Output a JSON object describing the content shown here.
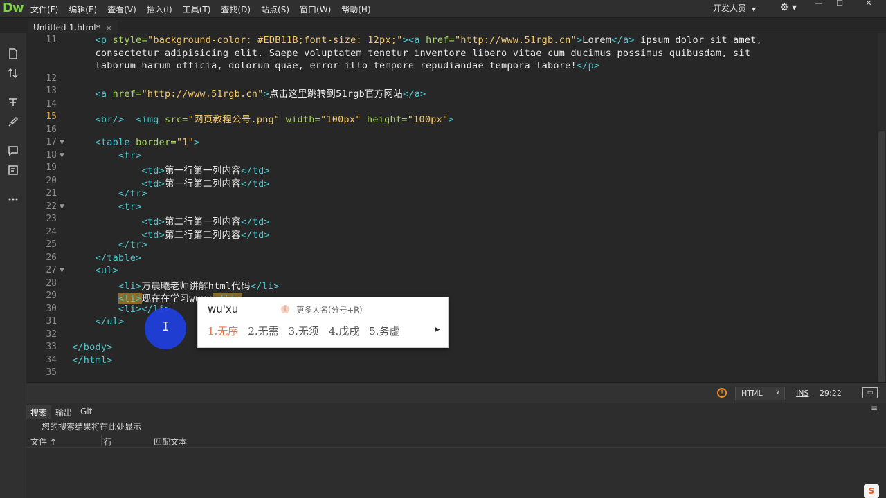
{
  "app": {
    "logo": "Dw",
    "menus": [
      "文件(F)",
      "编辑(E)",
      "查看(V)",
      "插入(I)",
      "工具(T)",
      "查找(D)",
      "站点(S)",
      "窗口(W)",
      "帮助(H)"
    ],
    "workspace": "开发人员",
    "gear": "⚙ ▾",
    "window_buttons": [
      "—",
      "☐",
      "✕"
    ]
  },
  "tab": {
    "label": "Untitled-1.html*",
    "close": "×"
  },
  "toolbar": [
    "file-icon",
    "sort-icon",
    "tree-icon",
    "brush-icon",
    "comment-icon",
    "snippet-icon",
    "more-icon"
  ],
  "editor": {
    "current_line": "15",
    "gutter": [
      {
        "n": "11",
        "fold": ""
      },
      {
        "n": "12",
        "fold": ""
      },
      {
        "n": "13",
        "fold": ""
      },
      {
        "n": "14",
        "fold": ""
      },
      {
        "n": "15",
        "fold": ""
      },
      {
        "n": "16",
        "fold": ""
      },
      {
        "n": "17",
        "fold": "▼"
      },
      {
        "n": "18",
        "fold": "▼"
      },
      {
        "n": "19",
        "fold": ""
      },
      {
        "n": "20",
        "fold": ""
      },
      {
        "n": "21",
        "fold": ""
      },
      {
        "n": "22",
        "fold": "▼"
      },
      {
        "n": "23",
        "fold": ""
      },
      {
        "n": "24",
        "fold": ""
      },
      {
        "n": "25",
        "fold": ""
      },
      {
        "n": "26",
        "fold": ""
      },
      {
        "n": "27",
        "fold": "▼"
      },
      {
        "n": "28",
        "fold": ""
      },
      {
        "n": "29",
        "fold": ""
      },
      {
        "n": "30",
        "fold": ""
      },
      {
        "n": "31",
        "fold": ""
      },
      {
        "n": "32",
        "fold": ""
      },
      {
        "n": "33",
        "fold": ""
      },
      {
        "n": "34",
        "fold": ""
      },
      {
        "n": "35",
        "fold": ""
      }
    ],
    "lines": [
      [
        {
          "c": "t",
          "v": "    <p "
        },
        {
          "c": "a",
          "v": "style="
        },
        {
          "c": "s",
          "v": "\"background-color: #EDB11B;font-size: 12px;\""
        },
        {
          "c": "t",
          "v": "><a "
        },
        {
          "c": "a",
          "v": "href="
        },
        {
          "c": "s",
          "v": "\"http://www.51rgb.cn\""
        },
        {
          "c": "t",
          "v": ">"
        },
        {
          "c": "tx",
          "v": "Lorem"
        },
        {
          "c": "t",
          "v": "</a>"
        },
        {
          "c": "tx",
          "v": " ipsum dolor sit amet,"
        }
      ],
      [
        {
          "c": "tx",
          "v": "    consectetur adipisicing elit. Saepe voluptatem tenetur inventore libero vitae cum ducimus possimus quibusdam, sit"
        }
      ],
      [
        {
          "c": "tx",
          "v": "    laborum harum officia, dolorum quae, error illo tempore repudiandae tempora labore!"
        },
        {
          "c": "t",
          "v": "</p>"
        }
      ],
      [],
      [
        {
          "c": "t",
          "v": "    <a "
        },
        {
          "c": "a",
          "v": "href="
        },
        {
          "c": "s",
          "v": "\"http://www.51rgb.cn\""
        },
        {
          "c": "t",
          "v": ">"
        },
        {
          "c": "tx",
          "v": "点击这里跳转到51rgb官方网站"
        },
        {
          "c": "t",
          "v": "</a>"
        }
      ],
      [],
      [
        {
          "c": "t",
          "v": "    <br/>  <img "
        },
        {
          "c": "a",
          "v": "src="
        },
        {
          "c": "s",
          "v": "\"网页教程公号.png\""
        },
        {
          "c": "a",
          "v": " width="
        },
        {
          "c": "s",
          "v": "\"100px\""
        },
        {
          "c": "a",
          "v": " height="
        },
        {
          "c": "s",
          "v": "\"100px\""
        },
        {
          "c": "t",
          "v": ">"
        }
      ],
      [],
      [
        {
          "c": "t",
          "v": "    <table "
        },
        {
          "c": "a",
          "v": "border="
        },
        {
          "c": "s",
          "v": "\"1\""
        },
        {
          "c": "t",
          "v": ">"
        }
      ],
      [
        {
          "c": "t",
          "v": "        <tr>"
        }
      ],
      [
        {
          "c": "t",
          "v": "            <td>"
        },
        {
          "c": "tx",
          "v": "第一行第一列内容"
        },
        {
          "c": "t",
          "v": "</td>"
        }
      ],
      [
        {
          "c": "t",
          "v": "            <td>"
        },
        {
          "c": "tx",
          "v": "第一行第二列内容"
        },
        {
          "c": "t",
          "v": "</td>"
        }
      ],
      [
        {
          "c": "t",
          "v": "        </tr>"
        }
      ],
      [
        {
          "c": "t",
          "v": "        <tr>"
        }
      ],
      [
        {
          "c": "t",
          "v": "            <td>"
        },
        {
          "c": "tx",
          "v": "第二行第一列内容"
        },
        {
          "c": "t",
          "v": "</td>"
        }
      ],
      [
        {
          "c": "t",
          "v": "            <td>"
        },
        {
          "c": "tx",
          "v": "第二行第二列内容"
        },
        {
          "c": "t",
          "v": "</td>"
        }
      ],
      [
        {
          "c": "t",
          "v": "        </tr>"
        }
      ],
      [
        {
          "c": "t",
          "v": "    </table>"
        }
      ],
      [
        {
          "c": "t",
          "v": "    <ul>"
        }
      ],
      [
        {
          "c": "t",
          "v": "        <li>"
        },
        {
          "c": "tx",
          "v": "万晨曦老师讲解html代码"
        },
        {
          "c": "t",
          "v": "</li>"
        }
      ],
      [
        {
          "c": "tx",
          "v": "        "
        },
        {
          "c": "t hl",
          "v": "<li>"
        },
        {
          "c": "tx",
          "v": "现在在学习wuxu"
        },
        {
          "c": "t hl",
          "v": "</li>"
        }
      ],
      [
        {
          "c": "t",
          "v": "        <li></li>"
        }
      ],
      [
        {
          "c": "t",
          "v": "    </ul>"
        }
      ],
      [],
      [
        {
          "c": "t",
          "v": "</body>"
        }
      ],
      [
        {
          "c": "t",
          "v": "</html>"
        }
      ],
      []
    ]
  },
  "status": {
    "warning": "!",
    "language": "HTML",
    "mode": "INS",
    "position": "29:22",
    "preview": "▭"
  },
  "panel": {
    "tabs": [
      "搜索",
      "输出",
      "Git"
    ],
    "message": "您的搜索结果将在此处显示",
    "columns": [
      "文件 ↑",
      "行",
      "匹配文本"
    ]
  },
  "ime": {
    "input": "wu'xu",
    "hint_icon": "i",
    "hint": "更多人名(分号+R)",
    "candidates": [
      "1.无序",
      "2.无需",
      "3.无须",
      "4.戊戌",
      "5.务虚"
    ],
    "next": "▶"
  },
  "tray": {
    "sogou": "S"
  }
}
